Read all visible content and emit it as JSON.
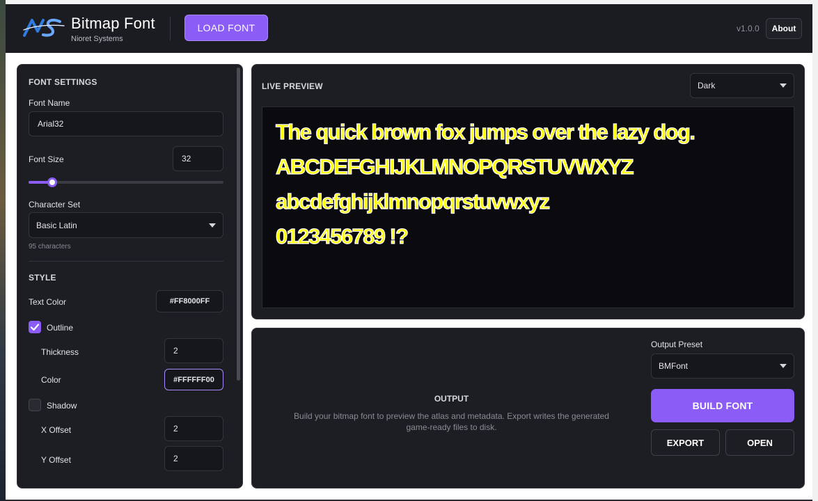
{
  "header": {
    "brand_title": "Bitmap Font",
    "brand_subtitle": "Nioret Systems",
    "load_button": "LOAD FONT",
    "version": "v1.0.0",
    "about_button": "About"
  },
  "font_settings": {
    "section_title": "FONT SETTINGS",
    "font_name_label": "Font Name",
    "font_name_value": "Arial32",
    "font_size_label": "Font Size",
    "font_size_value": "32",
    "font_size_slider_fraction": 0.12,
    "charset_label": "Character Set",
    "charset_value": "Basic Latin",
    "charset_count": "95 characters"
  },
  "style": {
    "section_title": "STYLE",
    "text_color_label": "Text Color",
    "text_color_value": "#FF8000FF",
    "outline_label": "Outline",
    "outline_checked": true,
    "thickness_label": "Thickness",
    "thickness_value": "2",
    "outline_color_label": "Color",
    "outline_color_value": "#FFFFFF00",
    "shadow_label": "Shadow",
    "shadow_checked": false,
    "x_offset_label": "X Offset",
    "x_offset_value": "2",
    "y_offset_label": "Y Offset",
    "y_offset_value": "2"
  },
  "preview": {
    "section_title": "LIVE PREVIEW",
    "theme_value": "Dark",
    "lines": [
      "The quick brown fox jumps over the lazy dog.",
      "ABCDEFGHIJKLMNOPQRSTUVWXYZ",
      "abcdefghijklmnopqrstuvwxyz",
      "0123456789 !?"
    ]
  },
  "output": {
    "title": "OUTPUT",
    "description": "Build your bitmap font to preview the atlas and metadata. Export writes the generated game-ready files to disk.",
    "preset_label": "Output Preset",
    "preset_value": "BMFont",
    "build_button": "BUILD FONT",
    "export_button": "EXPORT",
    "open_button": "OPEN"
  },
  "colors": {
    "accent": "#8b5cf6",
    "preview_text": "#ffff00",
    "preview_outline": "#ffffff",
    "background": "#1d1e23"
  }
}
